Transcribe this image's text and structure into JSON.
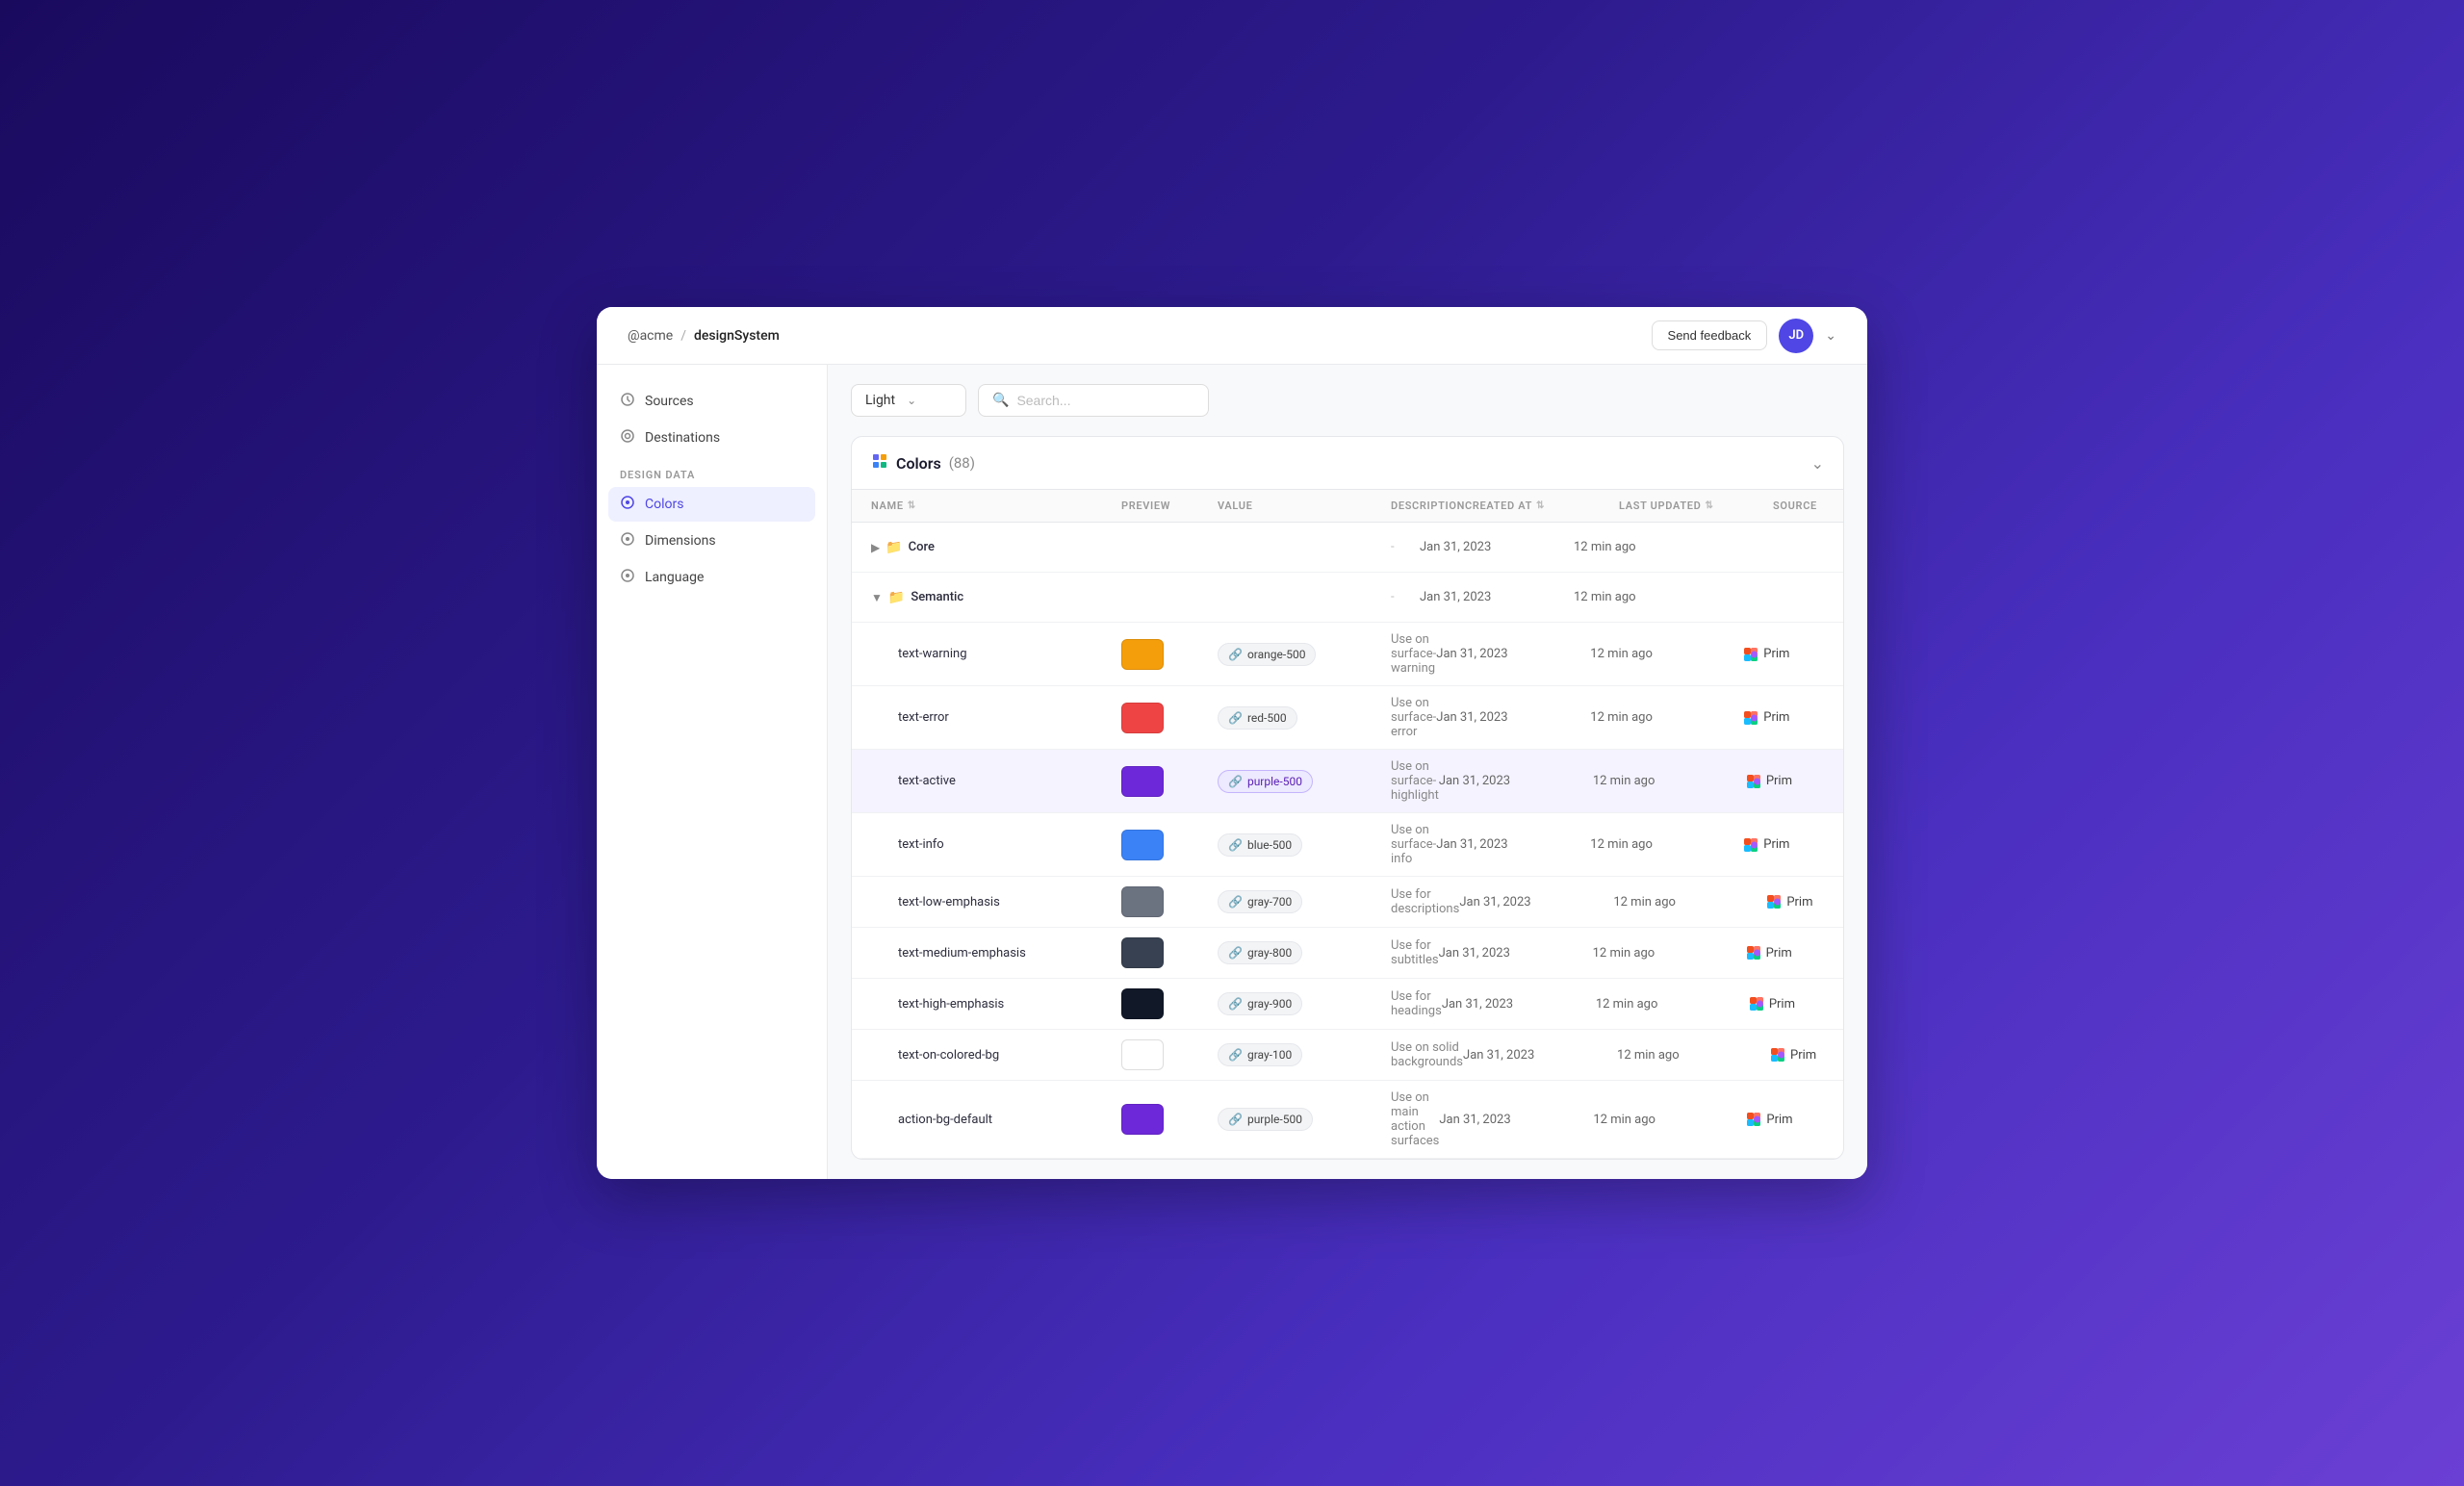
{
  "header": {
    "org": "@acme",
    "separator": "/",
    "page": "designSystem",
    "send_feedback": "Send feedback",
    "avatar_initials": "JD"
  },
  "sidebar": {
    "nav_items": [
      {
        "id": "sources",
        "label": "Sources",
        "icon": "↺"
      },
      {
        "id": "destinations",
        "label": "Destinations",
        "icon": "⊙"
      }
    ],
    "section_label": "DESIGN DATA",
    "design_items": [
      {
        "id": "colors",
        "label": "Colors",
        "icon": "◎",
        "active": true
      },
      {
        "id": "dimensions",
        "label": "Dimensions",
        "icon": "◎",
        "active": false
      },
      {
        "id": "language",
        "label": "Language",
        "icon": "◎",
        "active": false
      }
    ]
  },
  "toolbar": {
    "theme_label": "Light",
    "search_placeholder": "Search..."
  },
  "colors_section": {
    "title": "Colors",
    "count": "(88)",
    "columns": {
      "name": "NAME",
      "preview": "PREVIEW",
      "value": "VALUE",
      "description": "DESCRIPTION",
      "created_at": "CREATED AT",
      "last_updated": "LAST UPDATED",
      "source": "SOURCE"
    }
  },
  "table_rows": [
    {
      "type": "group",
      "name": "Core",
      "expanded": false,
      "description": "-",
      "created_at": "Jan 31, 2023",
      "last_updated": "12 min ago",
      "source": ""
    },
    {
      "type": "group",
      "name": "Semantic",
      "expanded": true,
      "description": "-",
      "created_at": "Jan 31, 2023",
      "last_updated": "12 min ago",
      "source": ""
    },
    {
      "type": "item",
      "name": "text-warning",
      "color": "#f59e0b",
      "value": "orange-500",
      "description": "Use on surface-warning",
      "created_at": "Jan 31, 2023",
      "last_updated": "12 min ago",
      "source": "Prim",
      "active": false
    },
    {
      "type": "item",
      "name": "text-error",
      "color": "#ef4444",
      "value": "red-500",
      "description": "Use on surface-error",
      "created_at": "Jan 31, 2023",
      "last_updated": "12 min ago",
      "source": "Prim",
      "active": false
    },
    {
      "type": "item",
      "name": "text-active",
      "color": "#6d28d9",
      "value": "purple-500",
      "description": "Use on surface-highlight",
      "created_at": "Jan 31, 2023",
      "last_updated": "12 min ago",
      "source": "Prim",
      "active": true
    },
    {
      "type": "item",
      "name": "text-info",
      "color": "#3b82f6",
      "value": "blue-500",
      "description": "Use on surface-info",
      "created_at": "Jan 31, 2023",
      "last_updated": "12 min ago",
      "source": "Prim",
      "active": false
    },
    {
      "type": "item",
      "name": "text-low-emphasis",
      "color": "#6b7280",
      "value": "gray-700",
      "description": "Use for descriptions",
      "created_at": "Jan 31, 2023",
      "last_updated": "12 min ago",
      "source": "Prim",
      "active": false
    },
    {
      "type": "item",
      "name": "text-medium-emphasis",
      "color": "#374151",
      "value": "gray-800",
      "description": "Use for subtitles",
      "created_at": "Jan 31, 2023",
      "last_updated": "12 min ago",
      "source": "Prim",
      "active": false
    },
    {
      "type": "item",
      "name": "text-high-emphasis",
      "color": "#111827",
      "value": "gray-900",
      "description": "Use for headings",
      "created_at": "Jan 31, 2023",
      "last_updated": "12 min ago",
      "source": "Prim",
      "active": false
    },
    {
      "type": "item",
      "name": "text-on-colored-bg",
      "color": "#ffffff",
      "value": "gray-100",
      "description": "Use on solid backgrounds",
      "created_at": "Jan 31, 2023",
      "last_updated": "12 min ago",
      "source": "Prim",
      "active": false,
      "white": true
    },
    {
      "type": "item",
      "name": "action-bg-default",
      "color": "#6d28d9",
      "value": "purple-500",
      "description": "Use on main action surfaces",
      "created_at": "Jan 31, 2023",
      "last_updated": "12 min ago",
      "source": "Prim",
      "active": false
    }
  ],
  "figma_icon_color": "#f24e1e"
}
